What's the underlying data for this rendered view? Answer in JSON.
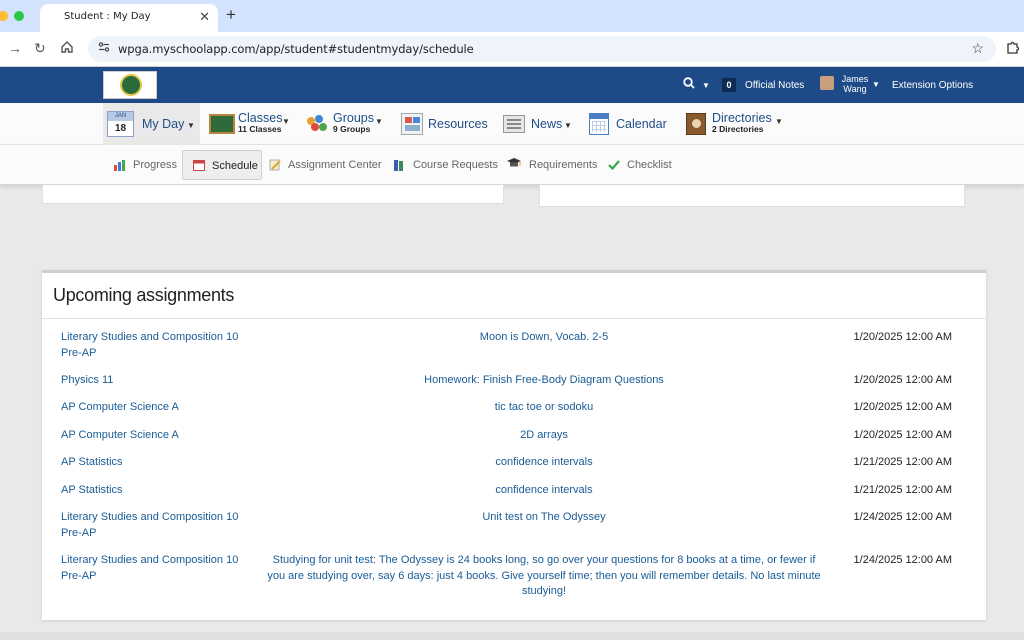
{
  "browser": {
    "tab_title": "Student : My Day",
    "tab_close": "✕",
    "new_tab": "+",
    "url": "wpga.myschoolapp.com/app/student#studentmyday/schedule"
  },
  "header": {
    "notes_count": "0",
    "notes_label": "Official Notes",
    "user_first": "James",
    "user_last": "Wang",
    "extension_options": "Extension Options"
  },
  "main_nav": {
    "myday": {
      "month": "JAN",
      "day": "18",
      "label": "My Day"
    },
    "classes": {
      "label": "Classes",
      "sub": "11 Classes"
    },
    "groups": {
      "label": "Groups",
      "sub": "9 Groups"
    },
    "resources": {
      "label": "Resources"
    },
    "news": {
      "label": "News"
    },
    "calendar": {
      "label": "Calendar"
    },
    "directories": {
      "label": "Directories",
      "sub": "2 Directories"
    }
  },
  "sub_nav": {
    "progress": "Progress",
    "schedule": "Schedule",
    "assignment_center": "Assignment Center",
    "course_requests": "Course Requests",
    "requirements": "Requirements",
    "checklist": "Checklist"
  },
  "upcoming": {
    "title": "Upcoming assignments",
    "rows": [
      {
        "course": "Literary Studies and Composition 10 Pre-AP",
        "assignment": "Moon is Down, Vocab. 2-5",
        "due": "1/20/2025 12:00 AM"
      },
      {
        "course": "Physics 11",
        "assignment": "Homework: Finish Free-Body Diagram Questions",
        "due": "1/20/2025 12:00 AM"
      },
      {
        "course": "AP Computer Science A",
        "assignment": "tic tac toe or sodoku",
        "due": "1/20/2025 12:00 AM"
      },
      {
        "course": "AP Computer Science A",
        "assignment": "2D arrays",
        "due": "1/20/2025 12:00 AM"
      },
      {
        "course": "AP Statistics",
        "assignment": "confidence intervals",
        "due": "1/21/2025 12:00 AM"
      },
      {
        "course": "AP Statistics",
        "assignment": "confidence intervals",
        "due": "1/21/2025 12:00 AM"
      },
      {
        "course": "Literary Studies and Composition 10 Pre-AP",
        "assignment": "Unit test on The Odyssey",
        "due": "1/24/2025 12:00 AM"
      },
      {
        "course": "Literary Studies and Composition 10 Pre-AP",
        "assignment": "Studying for unit test: The Odyssey is 24 books long, so go over your questions for 8 books at a time, or fewer if you are studying over, say 6 days: just 4 books. Give yourself time; then you will remember details. No last minute studying!",
        "due": "1/24/2025 12:00 AM"
      }
    ]
  }
}
